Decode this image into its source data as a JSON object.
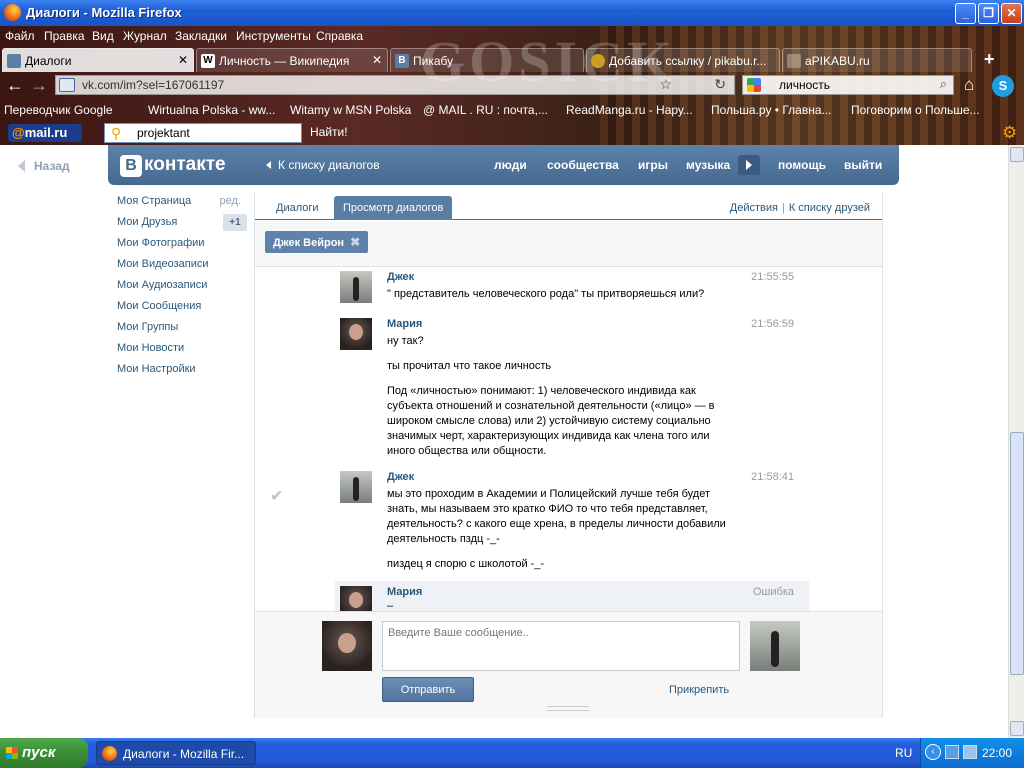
{
  "window": {
    "title": "Диалоги - Mozilla Firefox",
    "buttons": {
      "minimize": "_",
      "maximize": "❐",
      "close": "✕"
    }
  },
  "menu": [
    "Файл",
    "Правка",
    "Вид",
    "Журнал",
    "Закладки",
    "Инструменты",
    "Справка"
  ],
  "browser_tabs": [
    {
      "label": "Диалоги",
      "icon": "vk-icon"
    },
    {
      "label": "Личность — Википедия",
      "icon": "W"
    },
    {
      "label": "Пикабу",
      "icon": "B"
    },
    {
      "label": "Добавить ссылку / pikabu.r...",
      "icon": "pikabu-icon"
    },
    {
      "label": "aPIKABU.ru",
      "icon": "page-icon"
    }
  ],
  "new_tab": "+",
  "watermark": "GOSICK",
  "url": "vk.com/im?sel=167061197",
  "search": {
    "value": "личность"
  },
  "bookmarks": [
    "Переводчик Google",
    "Wirtualna Polska - ww...",
    "Witamy w MSN Polska",
    "@ MAIL . RU : почта,...",
    "ReadManga.ru - Нару...",
    "Польша.ру • Главна...",
    "Поговорим о Польше..."
  ],
  "mailru": {
    "logo_at": "@",
    "logo_text": "mail.ru",
    "input_value": "projektant",
    "find": "Найти!"
  },
  "vk": {
    "back": "Назад",
    "logo_letter": "В",
    "logo_text": "контакте",
    "to_dialogs": "К списку диалогов",
    "nav": [
      "люди",
      "сообщества",
      "игры",
      "музыка",
      "помощь",
      "выйти"
    ],
    "left_menu": [
      {
        "label": "Моя Страница",
        "extra": "ред."
      },
      {
        "label": "Мои Друзья",
        "badge": "+1"
      },
      {
        "label": "Мои Фотографии"
      },
      {
        "label": "Мои Видеозаписи"
      },
      {
        "label": "Мои Аудиозаписи"
      },
      {
        "label": "Мои Сообщения"
      },
      {
        "label": "Мои Группы"
      },
      {
        "label": "Мои Новости"
      },
      {
        "label": "Мои Настройки"
      }
    ],
    "tabs": [
      "Диалоги",
      "Просмотр диалогов"
    ],
    "actions": "Действия",
    "to_friends": "К списку друзей",
    "chip": "Джек Вейрон",
    "messages": [
      {
        "author": "Джек",
        "time": "21:55:55",
        "text": [
          "\" представитель человеческого рода\" ты притворяешься или?"
        ]
      },
      {
        "author": "Мария",
        "time": "21:56:59",
        "text": [
          "ну так?",
          "ты прочитал что такое личность",
          "Под «личностью» понимают: 1) человеческого индивида как субъекта отношений и сознательной деятельности («лицо» — в широком смысле слова) или 2) устойчивую систему социально значимых черт, характеризующих индивида как члена того или иного общества или общности."
        ]
      },
      {
        "author": "Джек",
        "time": "21:58:41",
        "text": [
          "мы это проходим в Академии и Полицейский лучше тебя будет знать, мы называем это кратко ФИО то что тебя представляет, деятельность? с какого еще хрена, в пределы личности добавили деятельность пздц -_-",
          "пиздец я спорю с школотой -_-"
        ]
      },
      {
        "author": "Мария",
        "time": "Ошибка",
        "text": [
          "–"
        ]
      }
    ],
    "compose": {
      "placeholder": "Введите Ваше сообщение..",
      "send": "Отправить",
      "attach": "Прикрепить"
    }
  },
  "taskbar": {
    "start": "пуск",
    "task": "Диалоги - Mozilla Fir...",
    "lang": "RU",
    "clock": "22:00"
  }
}
